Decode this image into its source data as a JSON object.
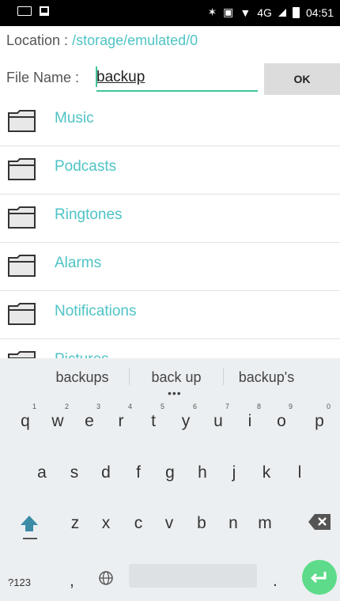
{
  "status_bar": {
    "network": "4G",
    "time": "04:51"
  },
  "location": {
    "label": "Location : ",
    "path": "/storage/emulated/0"
  },
  "file_name": {
    "label": "File Name : ",
    "value": "backup",
    "ok_label": "OK"
  },
  "folders": [
    "Music",
    "Podcasts",
    "Ringtones",
    "Alarms",
    "Notifications",
    "Pictures"
  ],
  "keyboard": {
    "suggestions": [
      "backups",
      "back up",
      "backup's"
    ],
    "row1": [
      "q",
      "w",
      "e",
      "r",
      "t",
      "y",
      "u",
      "i",
      "o",
      "p"
    ],
    "row1_numbers": [
      "1",
      "2",
      "3",
      "4",
      "5",
      "6",
      "7",
      "8",
      "9",
      "0"
    ],
    "row2": [
      "a",
      "s",
      "d",
      "f",
      "g",
      "h",
      "j",
      "k",
      "l"
    ],
    "row3": [
      "z",
      "x",
      "c",
      "v",
      "b",
      "n",
      "m"
    ],
    "symbols_label": "?123",
    "comma": ",",
    "period": "."
  },
  "icons": [
    "keyboard-icon",
    "image-icon",
    "bluetooth-icon",
    "vibrate-icon",
    "wifi-icon",
    "battery-icon",
    "folder-icon",
    "shift-icon",
    "backspace-icon",
    "globe-icon",
    "enter-icon"
  ]
}
